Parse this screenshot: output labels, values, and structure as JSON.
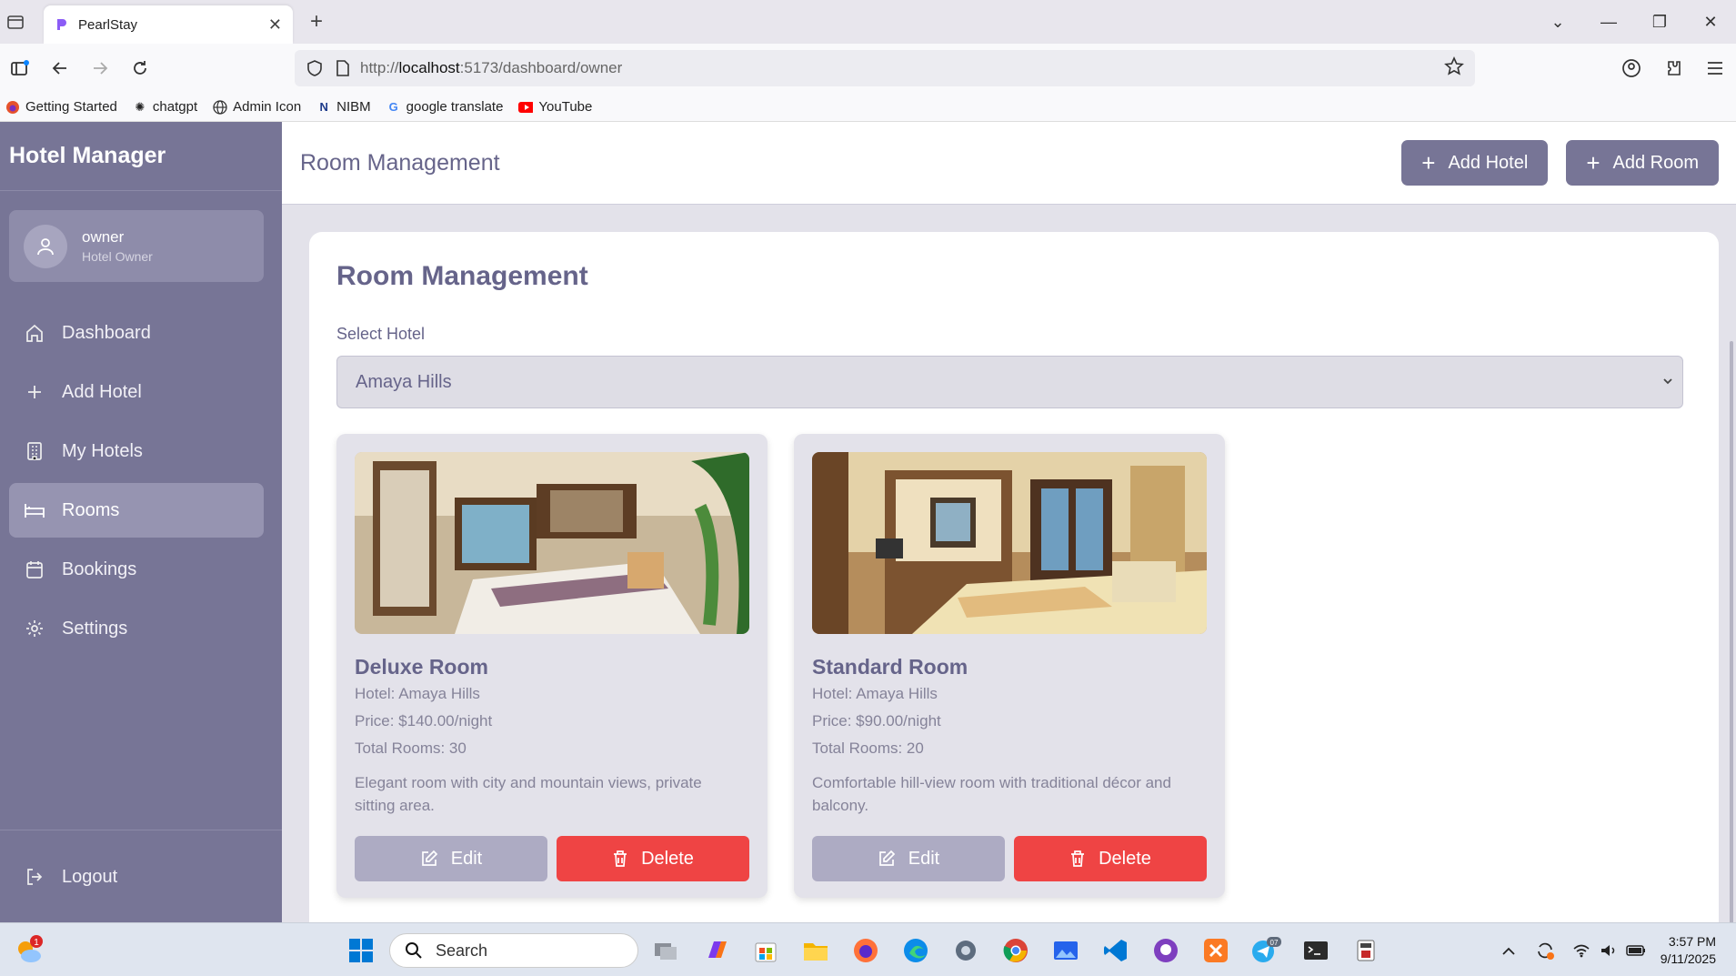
{
  "browser": {
    "tab_title": "PearlStay",
    "url_prefix": "http://",
    "url_host": "localhost",
    "url_rest": ":5173/dashboard/owner",
    "bookmarks": [
      {
        "label": "Getting Started",
        "icon": "firefox-icon"
      },
      {
        "label": "chatgpt",
        "icon": "openai-icon"
      },
      {
        "label": "Admin Icon",
        "icon": "globe-icon"
      },
      {
        "label": "NIBM",
        "icon": "nibm-icon"
      },
      {
        "label": "google translate",
        "icon": "google-icon"
      },
      {
        "label": "YouTube",
        "icon": "youtube-icon"
      }
    ]
  },
  "sidebar": {
    "brand": "Hotel Manager",
    "user": {
      "name": "owner",
      "role": "Hotel Owner"
    },
    "items": [
      {
        "label": "Dashboard",
        "icon": "home-icon"
      },
      {
        "label": "Add Hotel",
        "icon": "plus-icon"
      },
      {
        "label": "My Hotels",
        "icon": "building-icon"
      },
      {
        "label": "Rooms",
        "icon": "bed-icon",
        "active": true
      },
      {
        "label": "Bookings",
        "icon": "calendar-icon"
      },
      {
        "label": "Settings",
        "icon": "gear-icon"
      }
    ],
    "logout": "Logout"
  },
  "header": {
    "title": "Room Management",
    "add_hotel": "Add Hotel",
    "add_room": "Add Room"
  },
  "panel": {
    "title": "Room Management",
    "select_label": "Select Hotel",
    "selected_hotel": "Amaya Hills"
  },
  "rooms": [
    {
      "name": "Deluxe Room",
      "hotel": "Hotel: Amaya Hills",
      "price": "Price: $140.00/night",
      "total": "Total Rooms: 30",
      "description": "Elegant room with city and mountain views, private sitting area.",
      "edit": "Edit",
      "delete": "Delete"
    },
    {
      "name": "Standard Room",
      "hotel": "Hotel: Amaya Hills",
      "price": "Price: $90.00/night",
      "total": "Total Rooms: 20",
      "description": "Comfortable hill-view room with traditional décor and balcony.",
      "edit": "Edit",
      "delete": "Delete"
    }
  ],
  "taskbar": {
    "search_placeholder": "Search",
    "time": "3:57 PM",
    "date": "9/11/2025",
    "weather_badge": "1",
    "telegram_badge": "07"
  },
  "colors": {
    "sidebar": "#777596",
    "accent": "#66648a",
    "delete": "#ef4444"
  }
}
